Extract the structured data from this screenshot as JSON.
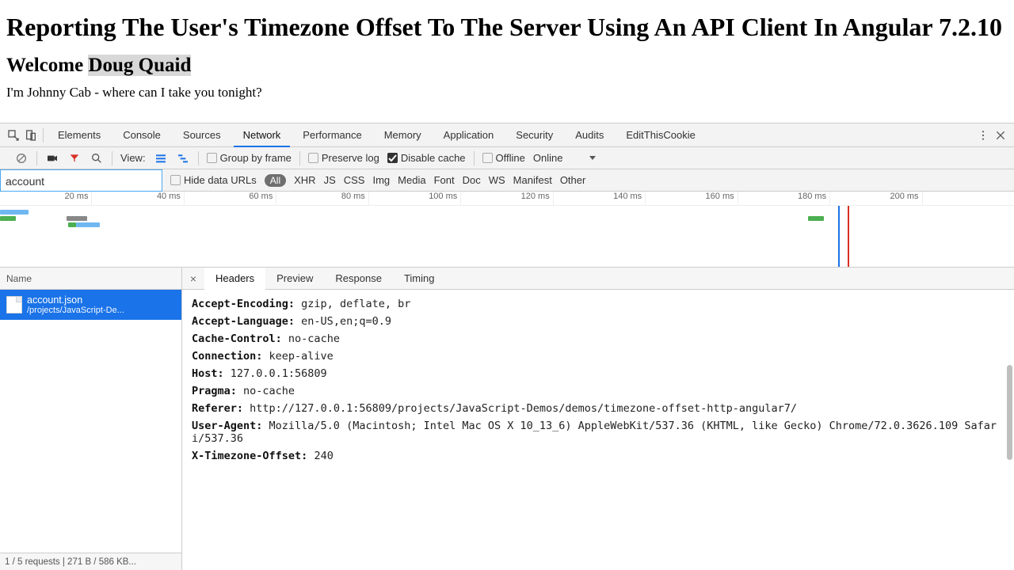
{
  "article": {
    "title": "Reporting The User's Timezone Offset To The Server Using An API Client In Angular 7.2.10",
    "welcome_prefix": "Welcome ",
    "welcome_name": "Doug Quaid",
    "body": "I'm Johnny Cab - where can I take you tonight?"
  },
  "devtools": {
    "tabs": [
      "Elements",
      "Console",
      "Sources",
      "Network",
      "Performance",
      "Memory",
      "Application",
      "Security",
      "Audits",
      "EditThisCookie"
    ],
    "active_tab": "Network",
    "toolbar": {
      "view": "View:",
      "group": "Group by frame",
      "preserve": "Preserve log",
      "disable_cache": "Disable cache",
      "offline": "Offline",
      "online": "Online"
    },
    "filter_value": "account",
    "hide_data_urls": "Hide data URLs",
    "filter_all": "All",
    "filter_types": [
      "XHR",
      "JS",
      "CSS",
      "Img",
      "Media",
      "Font",
      "Doc",
      "WS",
      "Manifest",
      "Other"
    ],
    "waterfall_ticks": [
      "20 ms",
      "40 ms",
      "60 ms",
      "80 ms",
      "100 ms",
      "120 ms",
      "140 ms",
      "160 ms",
      "180 ms",
      "200 ms"
    ],
    "name_header": "Name",
    "request": {
      "file": "account.json",
      "path": "/projects/JavaScript-De..."
    },
    "detail_tabs": [
      "Headers",
      "Preview",
      "Response",
      "Timing"
    ],
    "active_detail_tab": "Headers",
    "headers": [
      {
        "k": "Accept-Encoding:",
        "v": " gzip, deflate, br"
      },
      {
        "k": "Accept-Language:",
        "v": " en-US,en;q=0.9"
      },
      {
        "k": "Cache-Control:",
        "v": " no-cache"
      },
      {
        "k": "Connection:",
        "v": " keep-alive"
      },
      {
        "k": "Host:",
        "v": " 127.0.0.1:56809"
      },
      {
        "k": "Pragma:",
        "v": " no-cache"
      },
      {
        "k": "Referer:",
        "v": " http://127.0.0.1:56809/projects/JavaScript-Demos/demos/timezone-offset-http-angular7/"
      },
      {
        "k": "User-Agent:",
        "v": " Mozilla/5.0 (Macintosh; Intel Mac OS X 10_13_6) AppleWebKit/537.36 (KHTML, like Gecko) Chrome/72.0.3626.109 Safari/537.36"
      },
      {
        "k": "X-Timezone-Offset:",
        "v": " 240"
      }
    ],
    "status_bar": "1 / 5 requests | 271 B / 586 KB..."
  }
}
